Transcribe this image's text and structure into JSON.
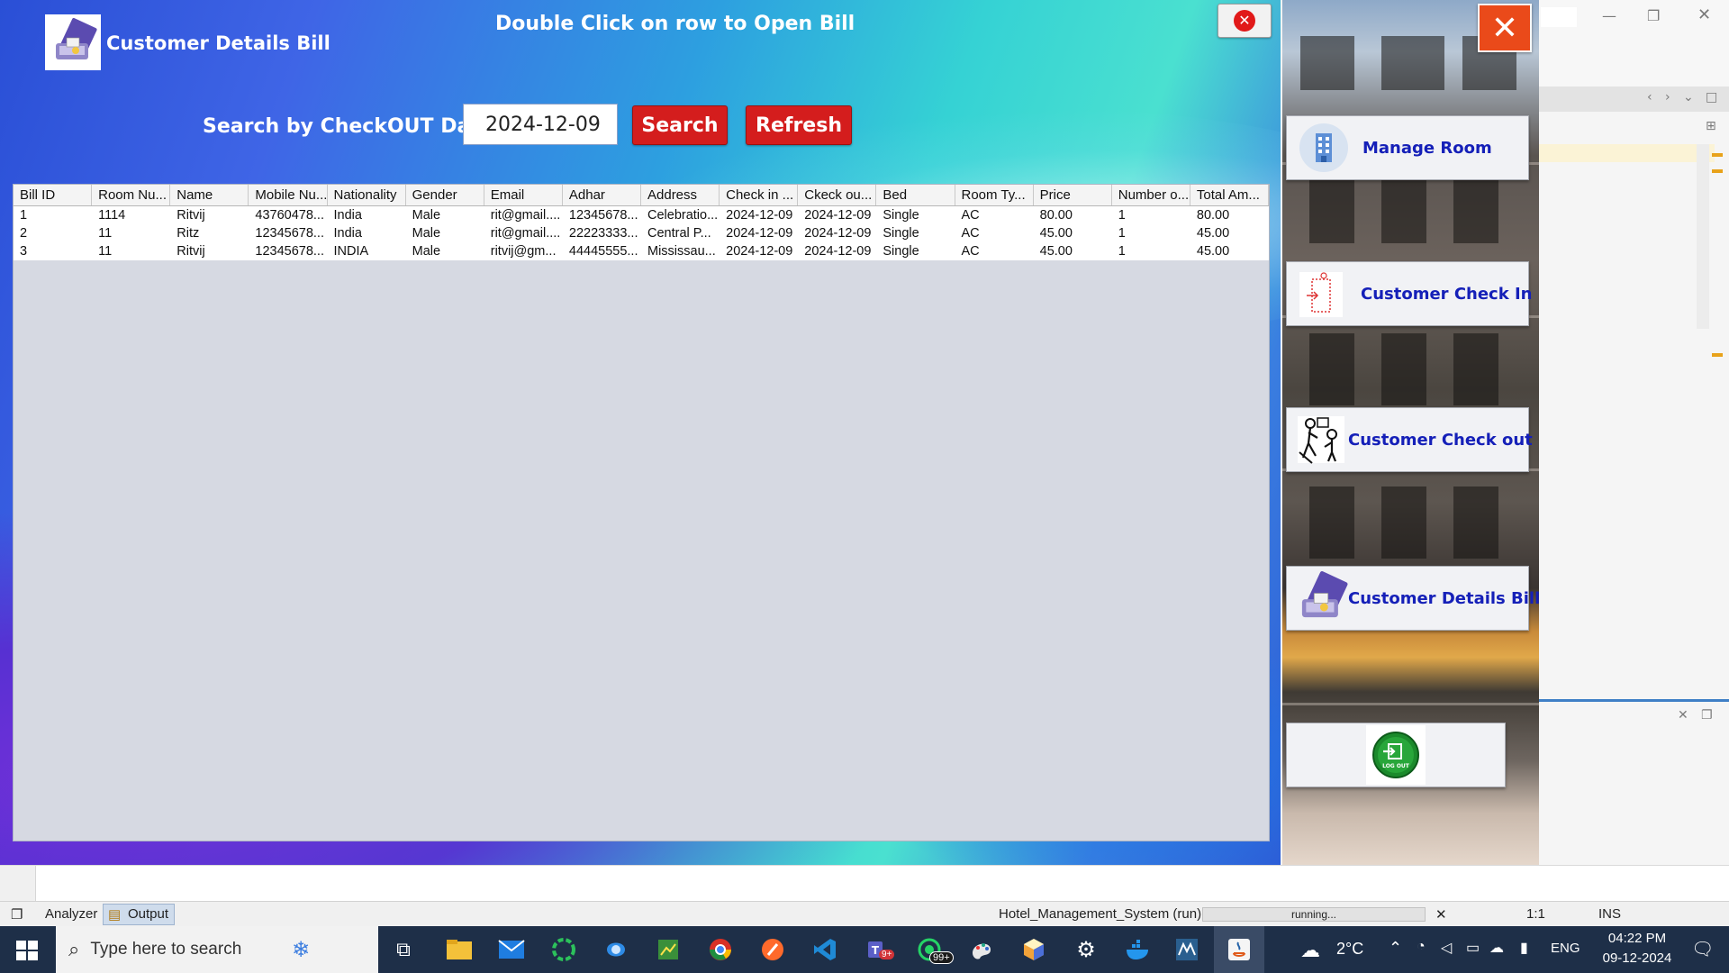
{
  "app": {
    "title": "Customer Details Bill",
    "hint": "Double Click on row to Open Bill",
    "search_label": "Search by CheckOUT Date",
    "search_date": "2024-12-09",
    "search_button": "Search",
    "refresh_button": "Refresh",
    "close_glyph": "✕"
  },
  "table": {
    "columns": [
      "Bill ID",
      "Room Nu...",
      "Name",
      "Mobile Nu...",
      "Nationality",
      "Gender",
      "Email",
      "Adhar",
      "Address",
      "Check in ...",
      "Ckeck ou...",
      "Bed",
      "Room Ty...",
      "Price",
      "Number o...",
      "Total Am..."
    ],
    "rows": [
      [
        "1",
        "1114",
        "Ritvij",
        "43760478...",
        "India",
        "Male",
        "rit@gmail....",
        "12345678...",
        "Celebratio...",
        "2024-12-09",
        "2024-12-09",
        "Single",
        "AC",
        "80.00",
        "1",
        "80.00"
      ],
      [
        "2",
        "11",
        "Ritz",
        "12345678...",
        "India",
        "Male",
        "rit@gmail....",
        "22223333...",
        "Central P...",
        "2024-12-09",
        "2024-12-09",
        "Single",
        "AC",
        "45.00",
        "1",
        "45.00"
      ],
      [
        "3",
        "11",
        "Ritvij",
        "12345678...",
        "INDIA",
        "Male",
        "ritvij@gm...",
        "44445555...",
        "Mississau...",
        "2024-12-09",
        "2024-12-09",
        "Single",
        "AC",
        "45.00",
        "1",
        "45.00"
      ]
    ]
  },
  "nav": {
    "manage_room": "Manage Room",
    "check_in": "Customer Check In",
    "check_out": "Customer Check out",
    "details_bill": "Customer Details Bill",
    "logout_text": "LOG OUT"
  },
  "ide": {
    "analyzer_tab": "Analyzer",
    "output_tab": "Output",
    "run_label": "Hotel_Management_System (run)",
    "progress_text": "running...",
    "cursor_pos": "1:1",
    "insert_mode": "INS"
  },
  "taskbar": {
    "search_placeholder": "Type here to search",
    "teams_badge": "9+",
    "whatsapp_badge": "99+",
    "weather": "2°C",
    "language": "ENG",
    "time": "04:22 PM",
    "date": "09-12-2024"
  },
  "colors": {
    "accent_red": "#d41d1d",
    "nav_label_blue": "#1520b8",
    "close_orange": "#ea4a1a"
  }
}
